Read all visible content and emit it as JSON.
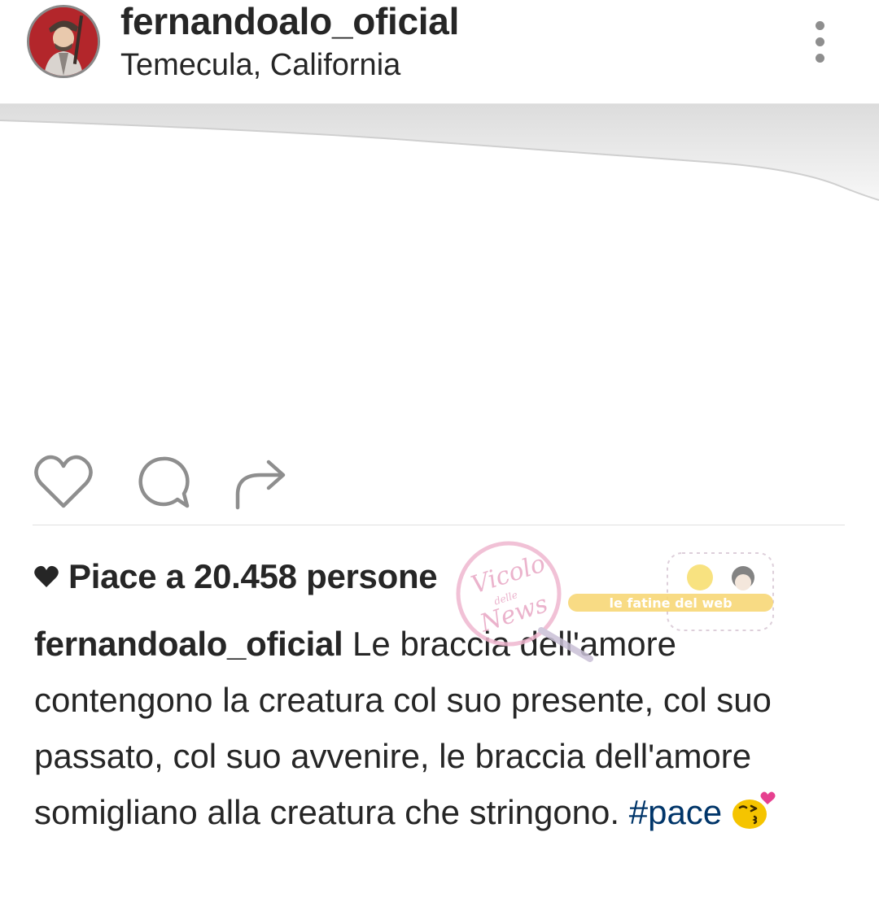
{
  "header": {
    "username": "fernandoalo_oficial",
    "location": "Temecula, California"
  },
  "icons": {
    "like": "heart-icon",
    "comment": "comment-icon",
    "share": "share-icon",
    "more": "more-vertical-icon"
  },
  "likes": {
    "text": "Piace a 20.458 persone"
  },
  "caption": {
    "author": "fernandoalo_oficial",
    "text": " Le braccia dell'amore contengono la creatura col suo presente, col suo passato, col suo avvenire, le braccia dell'amore somigliano alla creatura che stringono. ",
    "hashtag": "#pace"
  },
  "watermark": {
    "line1": "Vicolo",
    "line2": "delle",
    "line3": "News",
    "line4": "le fatine del web"
  },
  "colors": {
    "text": "#262626",
    "hashtag": "#003569",
    "icon_gray": "#8e8e8e",
    "avatar_bg": "#b3262b"
  }
}
